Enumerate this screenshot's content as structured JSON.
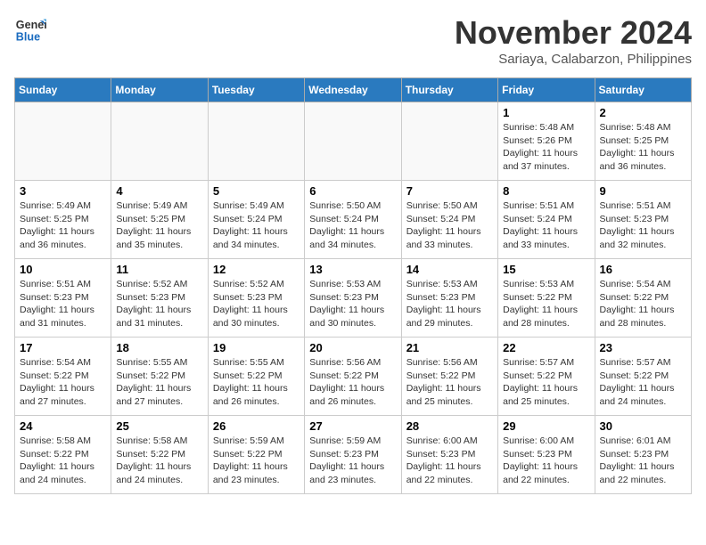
{
  "logo": {
    "line1": "General",
    "line2": "Blue"
  },
  "title": "November 2024",
  "location": "Sariaya, Calabarzon, Philippines",
  "weekdays": [
    "Sunday",
    "Monday",
    "Tuesday",
    "Wednesday",
    "Thursday",
    "Friday",
    "Saturday"
  ],
  "weeks": [
    [
      {
        "day": "",
        "info": ""
      },
      {
        "day": "",
        "info": ""
      },
      {
        "day": "",
        "info": ""
      },
      {
        "day": "",
        "info": ""
      },
      {
        "day": "",
        "info": ""
      },
      {
        "day": "1",
        "info": "Sunrise: 5:48 AM\nSunset: 5:26 PM\nDaylight: 11 hours and 37 minutes."
      },
      {
        "day": "2",
        "info": "Sunrise: 5:48 AM\nSunset: 5:25 PM\nDaylight: 11 hours and 36 minutes."
      }
    ],
    [
      {
        "day": "3",
        "info": "Sunrise: 5:49 AM\nSunset: 5:25 PM\nDaylight: 11 hours and 36 minutes."
      },
      {
        "day": "4",
        "info": "Sunrise: 5:49 AM\nSunset: 5:25 PM\nDaylight: 11 hours and 35 minutes."
      },
      {
        "day": "5",
        "info": "Sunrise: 5:49 AM\nSunset: 5:24 PM\nDaylight: 11 hours and 34 minutes."
      },
      {
        "day": "6",
        "info": "Sunrise: 5:50 AM\nSunset: 5:24 PM\nDaylight: 11 hours and 34 minutes."
      },
      {
        "day": "7",
        "info": "Sunrise: 5:50 AM\nSunset: 5:24 PM\nDaylight: 11 hours and 33 minutes."
      },
      {
        "day": "8",
        "info": "Sunrise: 5:51 AM\nSunset: 5:24 PM\nDaylight: 11 hours and 33 minutes."
      },
      {
        "day": "9",
        "info": "Sunrise: 5:51 AM\nSunset: 5:23 PM\nDaylight: 11 hours and 32 minutes."
      }
    ],
    [
      {
        "day": "10",
        "info": "Sunrise: 5:51 AM\nSunset: 5:23 PM\nDaylight: 11 hours and 31 minutes."
      },
      {
        "day": "11",
        "info": "Sunrise: 5:52 AM\nSunset: 5:23 PM\nDaylight: 11 hours and 31 minutes."
      },
      {
        "day": "12",
        "info": "Sunrise: 5:52 AM\nSunset: 5:23 PM\nDaylight: 11 hours and 30 minutes."
      },
      {
        "day": "13",
        "info": "Sunrise: 5:53 AM\nSunset: 5:23 PM\nDaylight: 11 hours and 30 minutes."
      },
      {
        "day": "14",
        "info": "Sunrise: 5:53 AM\nSunset: 5:23 PM\nDaylight: 11 hours and 29 minutes."
      },
      {
        "day": "15",
        "info": "Sunrise: 5:53 AM\nSunset: 5:22 PM\nDaylight: 11 hours and 28 minutes."
      },
      {
        "day": "16",
        "info": "Sunrise: 5:54 AM\nSunset: 5:22 PM\nDaylight: 11 hours and 28 minutes."
      }
    ],
    [
      {
        "day": "17",
        "info": "Sunrise: 5:54 AM\nSunset: 5:22 PM\nDaylight: 11 hours and 27 minutes."
      },
      {
        "day": "18",
        "info": "Sunrise: 5:55 AM\nSunset: 5:22 PM\nDaylight: 11 hours and 27 minutes."
      },
      {
        "day": "19",
        "info": "Sunrise: 5:55 AM\nSunset: 5:22 PM\nDaylight: 11 hours and 26 minutes."
      },
      {
        "day": "20",
        "info": "Sunrise: 5:56 AM\nSunset: 5:22 PM\nDaylight: 11 hours and 26 minutes."
      },
      {
        "day": "21",
        "info": "Sunrise: 5:56 AM\nSunset: 5:22 PM\nDaylight: 11 hours and 25 minutes."
      },
      {
        "day": "22",
        "info": "Sunrise: 5:57 AM\nSunset: 5:22 PM\nDaylight: 11 hours and 25 minutes."
      },
      {
        "day": "23",
        "info": "Sunrise: 5:57 AM\nSunset: 5:22 PM\nDaylight: 11 hours and 24 minutes."
      }
    ],
    [
      {
        "day": "24",
        "info": "Sunrise: 5:58 AM\nSunset: 5:22 PM\nDaylight: 11 hours and 24 minutes."
      },
      {
        "day": "25",
        "info": "Sunrise: 5:58 AM\nSunset: 5:22 PM\nDaylight: 11 hours and 24 minutes."
      },
      {
        "day": "26",
        "info": "Sunrise: 5:59 AM\nSunset: 5:22 PM\nDaylight: 11 hours and 23 minutes."
      },
      {
        "day": "27",
        "info": "Sunrise: 5:59 AM\nSunset: 5:23 PM\nDaylight: 11 hours and 23 minutes."
      },
      {
        "day": "28",
        "info": "Sunrise: 6:00 AM\nSunset: 5:23 PM\nDaylight: 11 hours and 22 minutes."
      },
      {
        "day": "29",
        "info": "Sunrise: 6:00 AM\nSunset: 5:23 PM\nDaylight: 11 hours and 22 minutes."
      },
      {
        "day": "30",
        "info": "Sunrise: 6:01 AM\nSunset: 5:23 PM\nDaylight: 11 hours and 22 minutes."
      }
    ]
  ]
}
